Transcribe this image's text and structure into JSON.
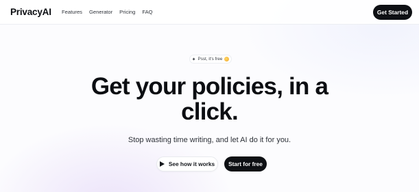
{
  "header": {
    "logo": "PrivacyAI",
    "nav": [
      "Features",
      "Generator",
      "Pricing",
      "FAQ"
    ],
    "cta": "Get Started"
  },
  "hero": {
    "badge": "Psst, it's free",
    "badge_icon": "sparkle-icon",
    "badge_emoji": "smile-emoji-icon",
    "title_line1": "Get your policies, in a",
    "title_line2": "click.",
    "subtitle": "Stop wasting time writing, and let AI do it for you.",
    "secondary_button": "See how it works",
    "primary_button": "Start for free"
  },
  "colors": {
    "primary_button_bg": "#0e1014",
    "text": "#0c0e12",
    "gradient_accent": "#dececf6"
  }
}
